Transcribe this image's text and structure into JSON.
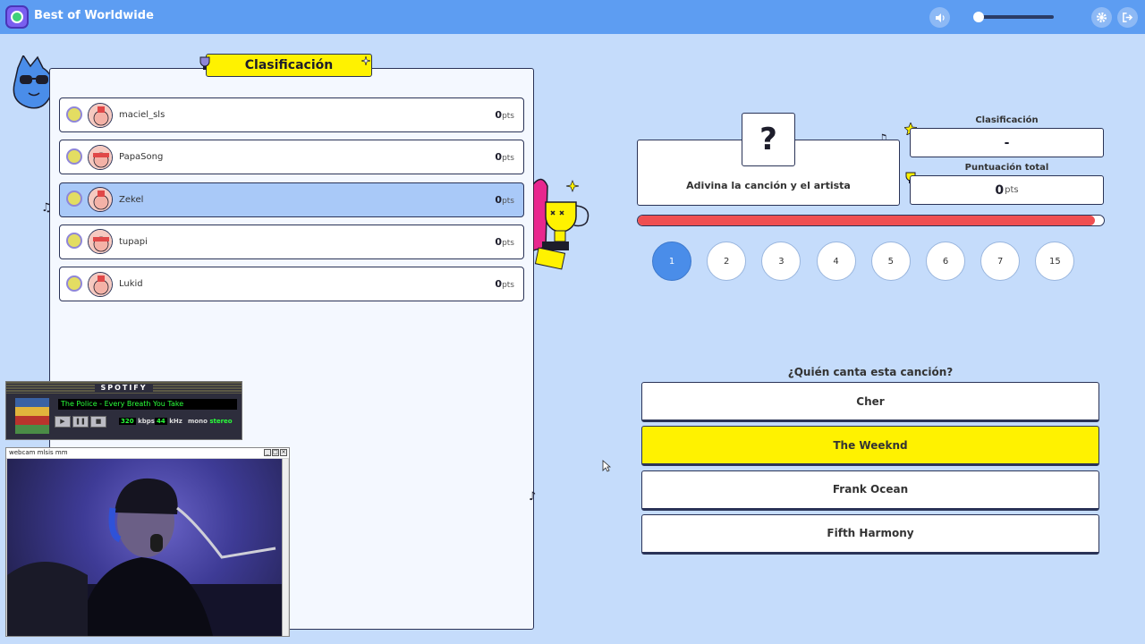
{
  "app": {
    "title": "Best of Worldwide"
  },
  "leaderboard": {
    "title": "Clasificación",
    "points_unit": "pts",
    "players": [
      {
        "name": "maciel_sls",
        "score": "0",
        "active": false
      },
      {
        "name": "PapaSong",
        "score": "0",
        "active": false
      },
      {
        "name": "Zekel",
        "score": "0",
        "active": true
      },
      {
        "name": "tupapi",
        "score": "0",
        "active": false
      },
      {
        "name": "Lukid",
        "score": "0",
        "active": false
      }
    ]
  },
  "question": {
    "symbol": "?",
    "prompt": "Adivina la canción y el artista",
    "ask": "¿Quién canta esta canción?",
    "progress": 0.98,
    "options": [
      {
        "label": "Cher",
        "selected": false
      },
      {
        "label": "The Weeknd",
        "selected": true
      },
      {
        "label": "Frank Ocean",
        "selected": false
      },
      {
        "label": "Fifth Harmony",
        "selected": false
      }
    ]
  },
  "stats": {
    "rank_label": "Clasificación",
    "rank_value": "-",
    "total_label": "Puntuación total",
    "total_value": "0",
    "total_unit": "pts"
  },
  "rounds": [
    "1",
    "2",
    "3",
    "4",
    "5",
    "6",
    "7",
    "15"
  ],
  "current_round": "1",
  "volume": 0.03,
  "spotify": {
    "title": "SPOTIFY",
    "track": "The Police - Every Breath You Take",
    "kbps": "320",
    "kbps_label": "kbps",
    "khz": "44",
    "khz_label": "kHz",
    "mono": "mono",
    "stereo": "stereo"
  },
  "webcam": {
    "title": "webcam mlsis mm"
  },
  "colors": {
    "background": "#c5dcfb",
    "topbar": "#5d9df2",
    "accent_yellow": "#fff200",
    "progress_red": "#ef4f51",
    "active_row": "#a9c9f8",
    "round_current": "#4a8de9"
  },
  "icons": {
    "volume": "speaker-icon",
    "settings": "gear-icon",
    "exit": "logout-icon"
  }
}
